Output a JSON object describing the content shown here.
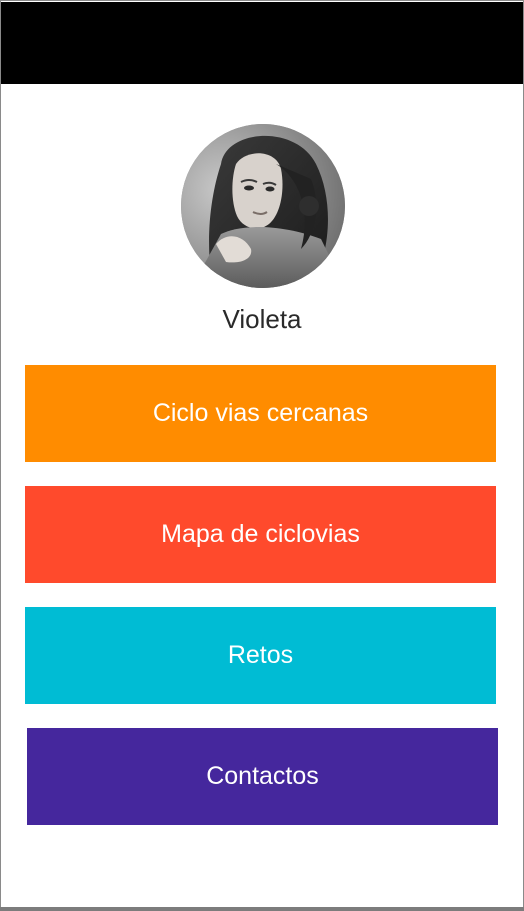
{
  "profile": {
    "name": "Violeta"
  },
  "menu": {
    "items": [
      {
        "label": "Ciclo vias cercanas",
        "color": "#FF8C00"
      },
      {
        "label": "Mapa de ciclovias",
        "color": "#FF4A2C"
      },
      {
        "label": "Retos",
        "color": "#00BCD4"
      },
      {
        "label": "Contactos",
        "color": "#45279D"
      }
    ]
  }
}
